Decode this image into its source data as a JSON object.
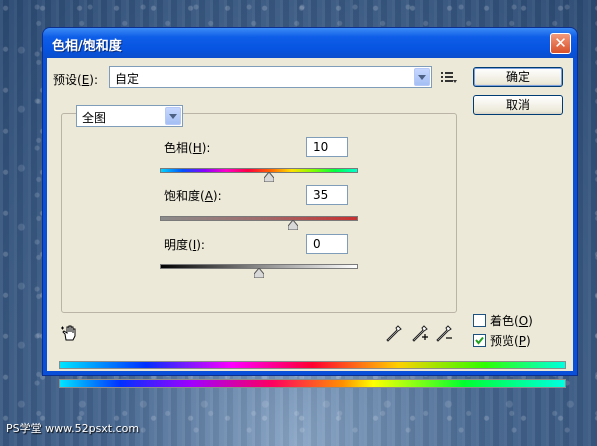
{
  "window": {
    "title": "色相/饱和度",
    "close_glyph": "✕"
  },
  "preset": {
    "label": "预设(",
    "label_key": "E",
    "label_end": "):",
    "value": "自定"
  },
  "buttons": {
    "ok": "确定",
    "cancel": "取消"
  },
  "channel": {
    "value": "全图"
  },
  "hue": {
    "label": "色相(",
    "key": "H",
    "label_end": "):",
    "value": "10",
    "level_fraction": 0.55
  },
  "saturation": {
    "label": "饱和度(",
    "key": "A",
    "label_end": "):",
    "value": "35",
    "level_fraction": 0.67
  },
  "lightness": {
    "label": "明度(",
    "key": "I",
    "label_end": "):",
    "value": "0",
    "level_fraction": 0.5
  },
  "options": {
    "colorize": {
      "label": "着色(",
      "key": "O",
      "label_end": ")",
      "checked": false
    },
    "preview": {
      "label": "预览(",
      "key": "P",
      "label_end": ")",
      "checked": true
    }
  },
  "icons": [
    "targeted-adjust-hand-icon",
    "eyedropper-icon",
    "eyedropper-plus-icon",
    "eyedropper-minus-icon",
    "preset-menu-icon"
  ],
  "colors": {
    "titlebar": "#0654e1",
    "client": "#ece9d8",
    "accent_check": "#21a121"
  },
  "watermark": {
    "text": "PS学堂  www.52psxt.com"
  }
}
